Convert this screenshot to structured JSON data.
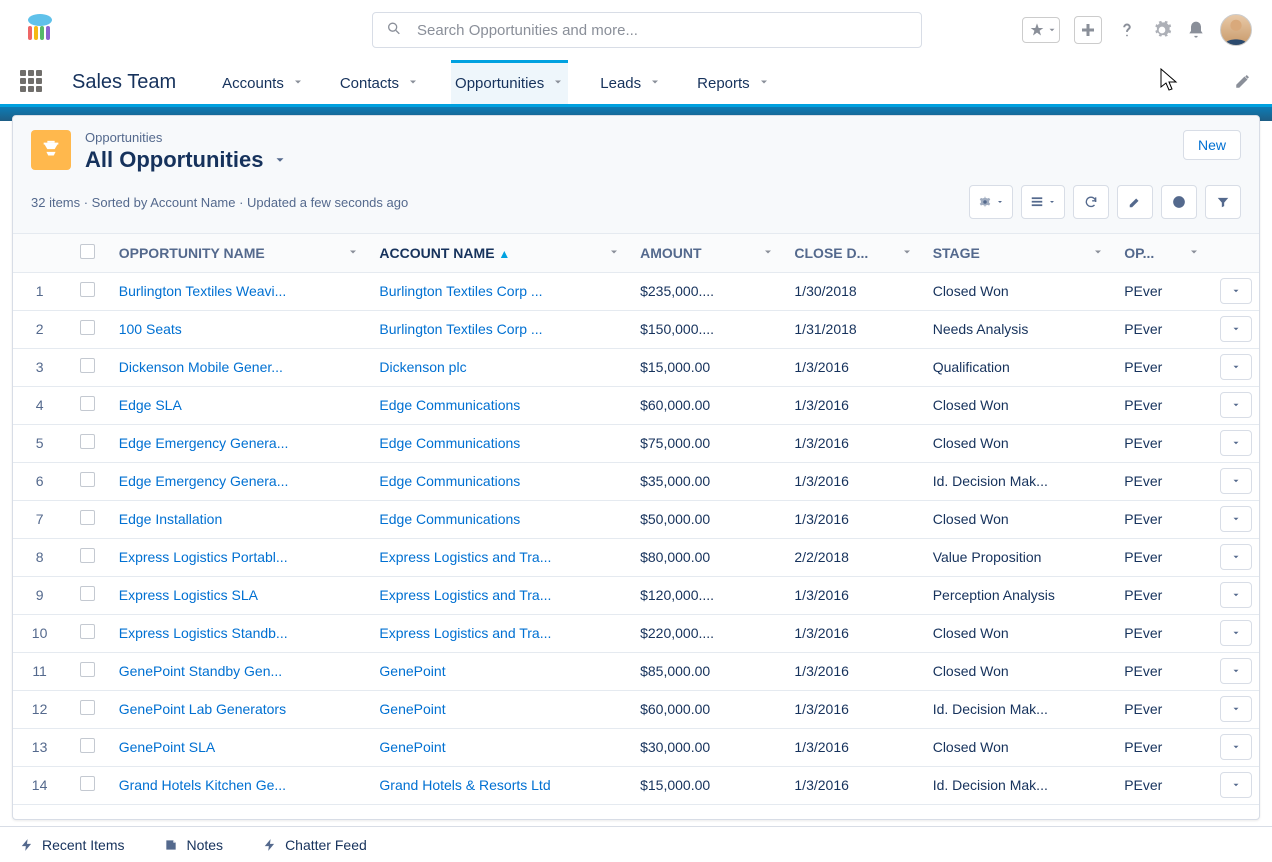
{
  "search": {
    "placeholder": "Search Opportunities and more..."
  },
  "app_name": "Sales Team",
  "nav_items": [
    {
      "label": "Accounts",
      "active": false
    },
    {
      "label": "Contacts",
      "active": false
    },
    {
      "label": "Opportunities",
      "active": true
    },
    {
      "label": "Leads",
      "active": false
    },
    {
      "label": "Reports",
      "active": false
    }
  ],
  "object_label": "Opportunities",
  "list_title": "All Opportunities",
  "btn_new": "New",
  "subheader": "32 items · Sorted by Account Name · Updated a few seconds ago",
  "columns": [
    {
      "key": "opportunity",
      "label": "OPPORTUNITY NAME"
    },
    {
      "key": "account",
      "label": "ACCOUNT NAME",
      "sorted": "asc"
    },
    {
      "key": "amount",
      "label": "AMOUNT"
    },
    {
      "key": "close",
      "label": "CLOSE D..."
    },
    {
      "key": "stage",
      "label": "STAGE"
    },
    {
      "key": "owner",
      "label": "OP..."
    }
  ],
  "rows": [
    {
      "n": "1",
      "opp": "Burlington Textiles Weavi...",
      "acc": "Burlington Textiles Corp ...",
      "amt": "$235,000....",
      "close": "1/30/2018",
      "stage": "Closed Won",
      "owner": "PEver"
    },
    {
      "n": "2",
      "opp": "100 Seats",
      "acc": "Burlington Textiles Corp ...",
      "amt": "$150,000....",
      "close": "1/31/2018",
      "stage": "Needs Analysis",
      "owner": "PEver"
    },
    {
      "n": "3",
      "opp": "Dickenson Mobile Gener...",
      "acc": "Dickenson plc",
      "amt": "$15,000.00",
      "close": "1/3/2016",
      "stage": "Qualification",
      "owner": "PEver"
    },
    {
      "n": "4",
      "opp": "Edge SLA",
      "acc": "Edge Communications",
      "amt": "$60,000.00",
      "close": "1/3/2016",
      "stage": "Closed Won",
      "owner": "PEver"
    },
    {
      "n": "5",
      "opp": "Edge Emergency Genera...",
      "acc": "Edge Communications",
      "amt": "$75,000.00",
      "close": "1/3/2016",
      "stage": "Closed Won",
      "owner": "PEver"
    },
    {
      "n": "6",
      "opp": "Edge Emergency Genera...",
      "acc": "Edge Communications",
      "amt": "$35,000.00",
      "close": "1/3/2016",
      "stage": "Id. Decision Mak...",
      "owner": "PEver"
    },
    {
      "n": "7",
      "opp": "Edge Installation",
      "acc": "Edge Communications",
      "amt": "$50,000.00",
      "close": "1/3/2016",
      "stage": "Closed Won",
      "owner": "PEver"
    },
    {
      "n": "8",
      "opp": "Express Logistics Portabl...",
      "acc": "Express Logistics and Tra...",
      "amt": "$80,000.00",
      "close": "2/2/2018",
      "stage": "Value Proposition",
      "owner": "PEver"
    },
    {
      "n": "9",
      "opp": "Express Logistics SLA",
      "acc": "Express Logistics and Tra...",
      "amt": "$120,000....",
      "close": "1/3/2016",
      "stage": "Perception Analysis",
      "owner": "PEver"
    },
    {
      "n": "10",
      "opp": "Express Logistics Standb...",
      "acc": "Express Logistics and Tra...",
      "amt": "$220,000....",
      "close": "1/3/2016",
      "stage": "Closed Won",
      "owner": "PEver"
    },
    {
      "n": "11",
      "opp": "GenePoint Standby Gen...",
      "acc": "GenePoint",
      "amt": "$85,000.00",
      "close": "1/3/2016",
      "stage": "Closed Won",
      "owner": "PEver"
    },
    {
      "n": "12",
      "opp": "GenePoint Lab Generators",
      "acc": "GenePoint",
      "amt": "$60,000.00",
      "close": "1/3/2016",
      "stage": "Id. Decision Mak...",
      "owner": "PEver"
    },
    {
      "n": "13",
      "opp": "GenePoint SLA",
      "acc": "GenePoint",
      "amt": "$30,000.00",
      "close": "1/3/2016",
      "stage": "Closed Won",
      "owner": "PEver"
    },
    {
      "n": "14",
      "opp": "Grand Hotels Kitchen Ge...",
      "acc": "Grand Hotels & Resorts Ltd",
      "amt": "$15,000.00",
      "close": "1/3/2016",
      "stage": "Id. Decision Mak...",
      "owner": "PEver"
    }
  ],
  "footer": {
    "recent": "Recent Items",
    "notes": "Notes",
    "chatter": "Chatter Feed"
  }
}
